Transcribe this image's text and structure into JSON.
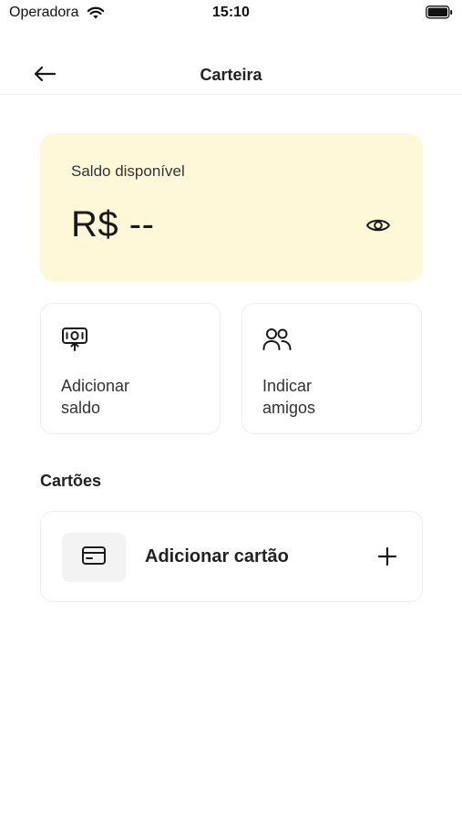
{
  "status_bar": {
    "carrier": "Operadora",
    "time": "15:10"
  },
  "nav": {
    "title": "Carteira"
  },
  "balance": {
    "label": "Saldo disponível",
    "value": "R$ --"
  },
  "actions": [
    {
      "line1": "Adicionar",
      "line2": "saldo",
      "icon": "add-money-icon"
    },
    {
      "line1": "Indicar",
      "line2": "amigos",
      "icon": "users-icon"
    }
  ],
  "cards_section": {
    "title": "Cartões",
    "add_card_label": "Adicionar cartão"
  },
  "colors": {
    "balance_card_bg": "#fef8d8",
    "text_primary": "#1f1f1f",
    "card_border": "#ececec"
  }
}
